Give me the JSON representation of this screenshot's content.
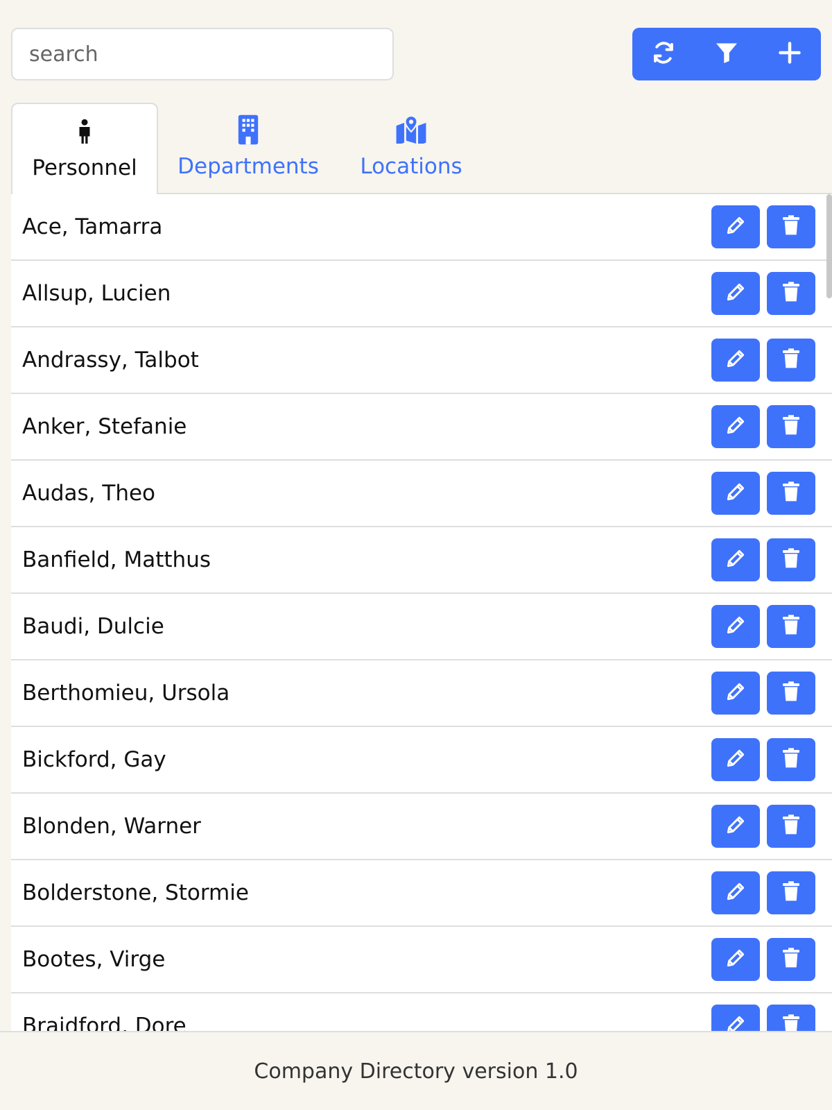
{
  "search": {
    "placeholder": "search",
    "value": ""
  },
  "toolbar": {
    "icons": [
      "refresh-icon",
      "filter-icon",
      "plus-icon"
    ],
    "accent": "#3f72fb"
  },
  "tabs": [
    {
      "label": "Personnel",
      "icon": "person-icon",
      "active": true
    },
    {
      "label": "Departments",
      "icon": "building-icon",
      "active": false
    },
    {
      "label": "Locations",
      "icon": "map-location-icon",
      "active": false
    }
  ],
  "personnel": [
    "Ace, Tamarra",
    "Allsup, Lucien",
    "Andrassy, Talbot",
    "Anker, Stefanie",
    "Audas, Theo",
    "Banfield, Matthus",
    "Baudi, Dulcie",
    "Berthomieu, Ursola",
    "Bickford, Gay",
    "Blonden, Warner",
    "Bolderstone, Stormie",
    "Bootes, Virge",
    "Braidford, Dore"
  ],
  "row_actions": {
    "edit_icon": "pencil-icon",
    "delete_icon": "trash-icon"
  },
  "footer": {
    "text": "Company Directory version 1.0"
  }
}
